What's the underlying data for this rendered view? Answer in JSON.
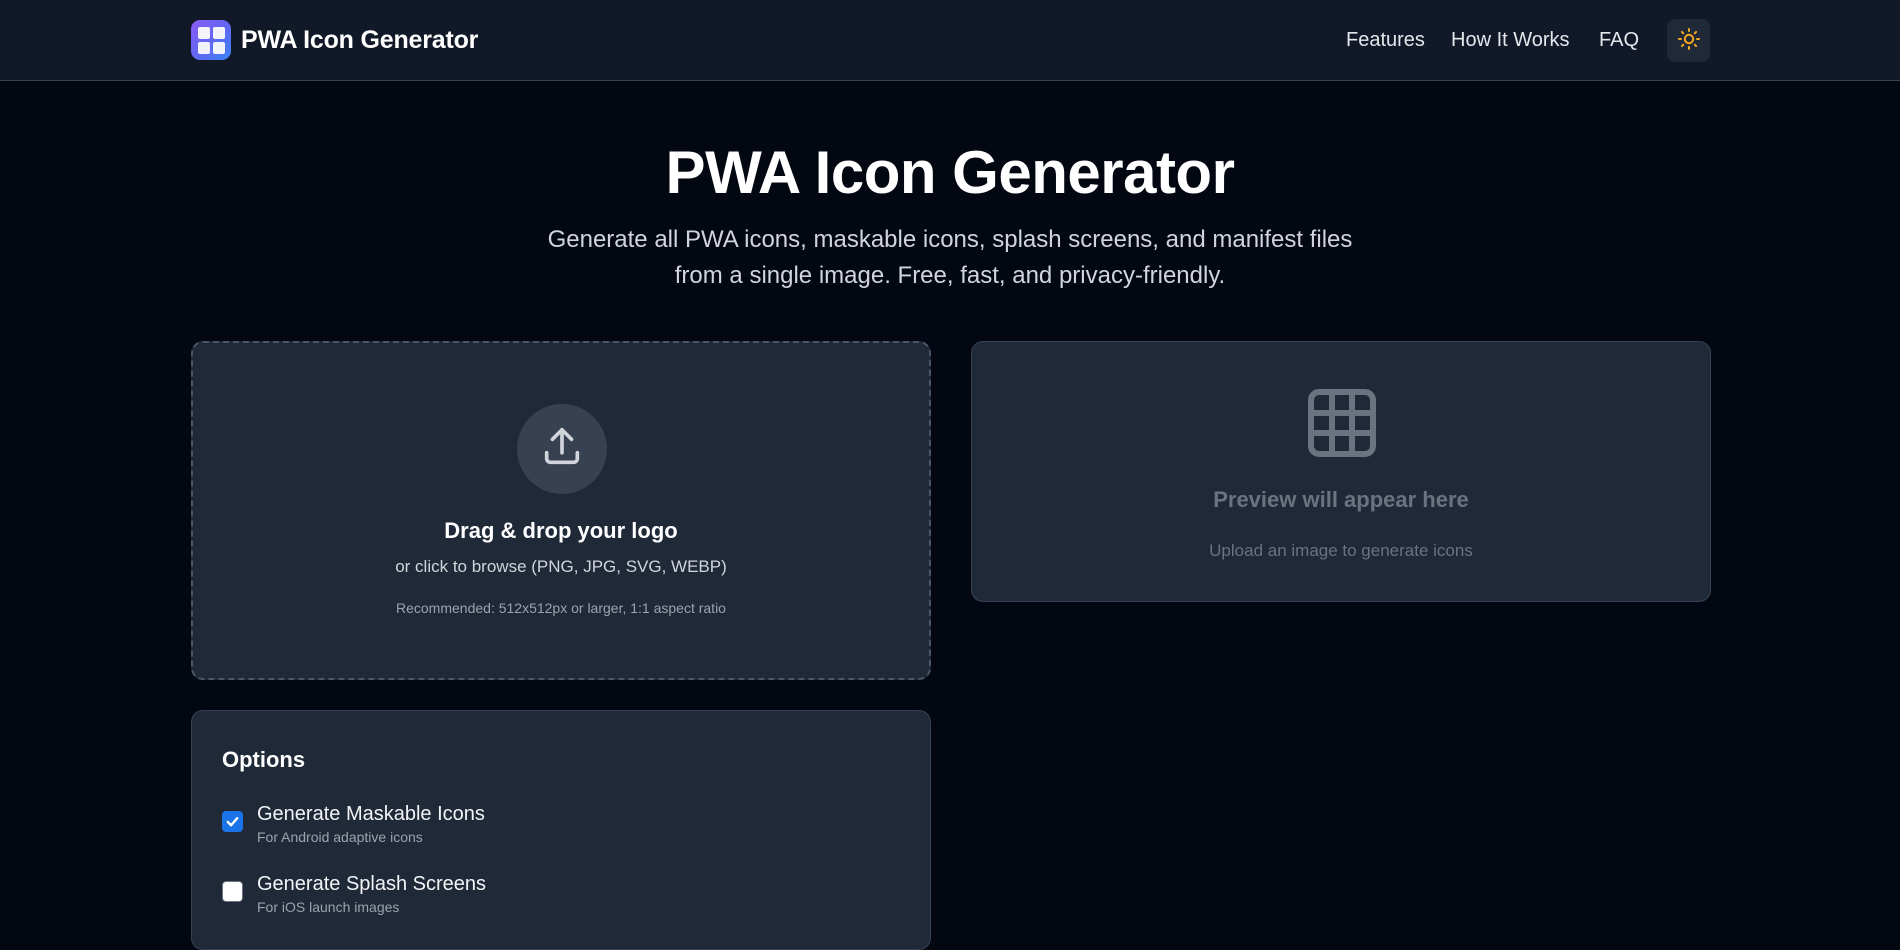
{
  "header": {
    "brand_title": "PWA Icon Generator",
    "nav": {
      "features": "Features",
      "how_it_works": "How It Works",
      "faq": "FAQ"
    },
    "theme_icon": "sun-icon"
  },
  "hero": {
    "title": "PWA Icon Generator",
    "subtitle_line1": "Generate all PWA icons, maskable icons, splash screens, and manifest files",
    "subtitle_line2": "from a single image. Free, fast, and privacy-friendly."
  },
  "upload": {
    "icon": "upload-icon",
    "title": "Drag & drop your logo",
    "subtitle": "or click to browse (PNG, JPG, SVG, WEBP)",
    "hint": "Recommended: 512x512px or larger, 1:1 aspect ratio"
  },
  "preview": {
    "icon": "grid-icon",
    "title": "Preview will appear here",
    "subtitle": "Upload an image to generate icons"
  },
  "options": {
    "title": "Options",
    "items": [
      {
        "label": "Generate Maskable Icons",
        "description": "For Android adaptive icons",
        "checked": true
      },
      {
        "label": "Generate Splash Screens",
        "description": "For iOS launch images",
        "checked": false
      }
    ]
  },
  "colors": {
    "page_background": "#030712",
    "header_background": "#111827",
    "card_background": "#1f2937",
    "checkbox_accent": "#1a73e8",
    "theme_icon": "#f5a623"
  }
}
